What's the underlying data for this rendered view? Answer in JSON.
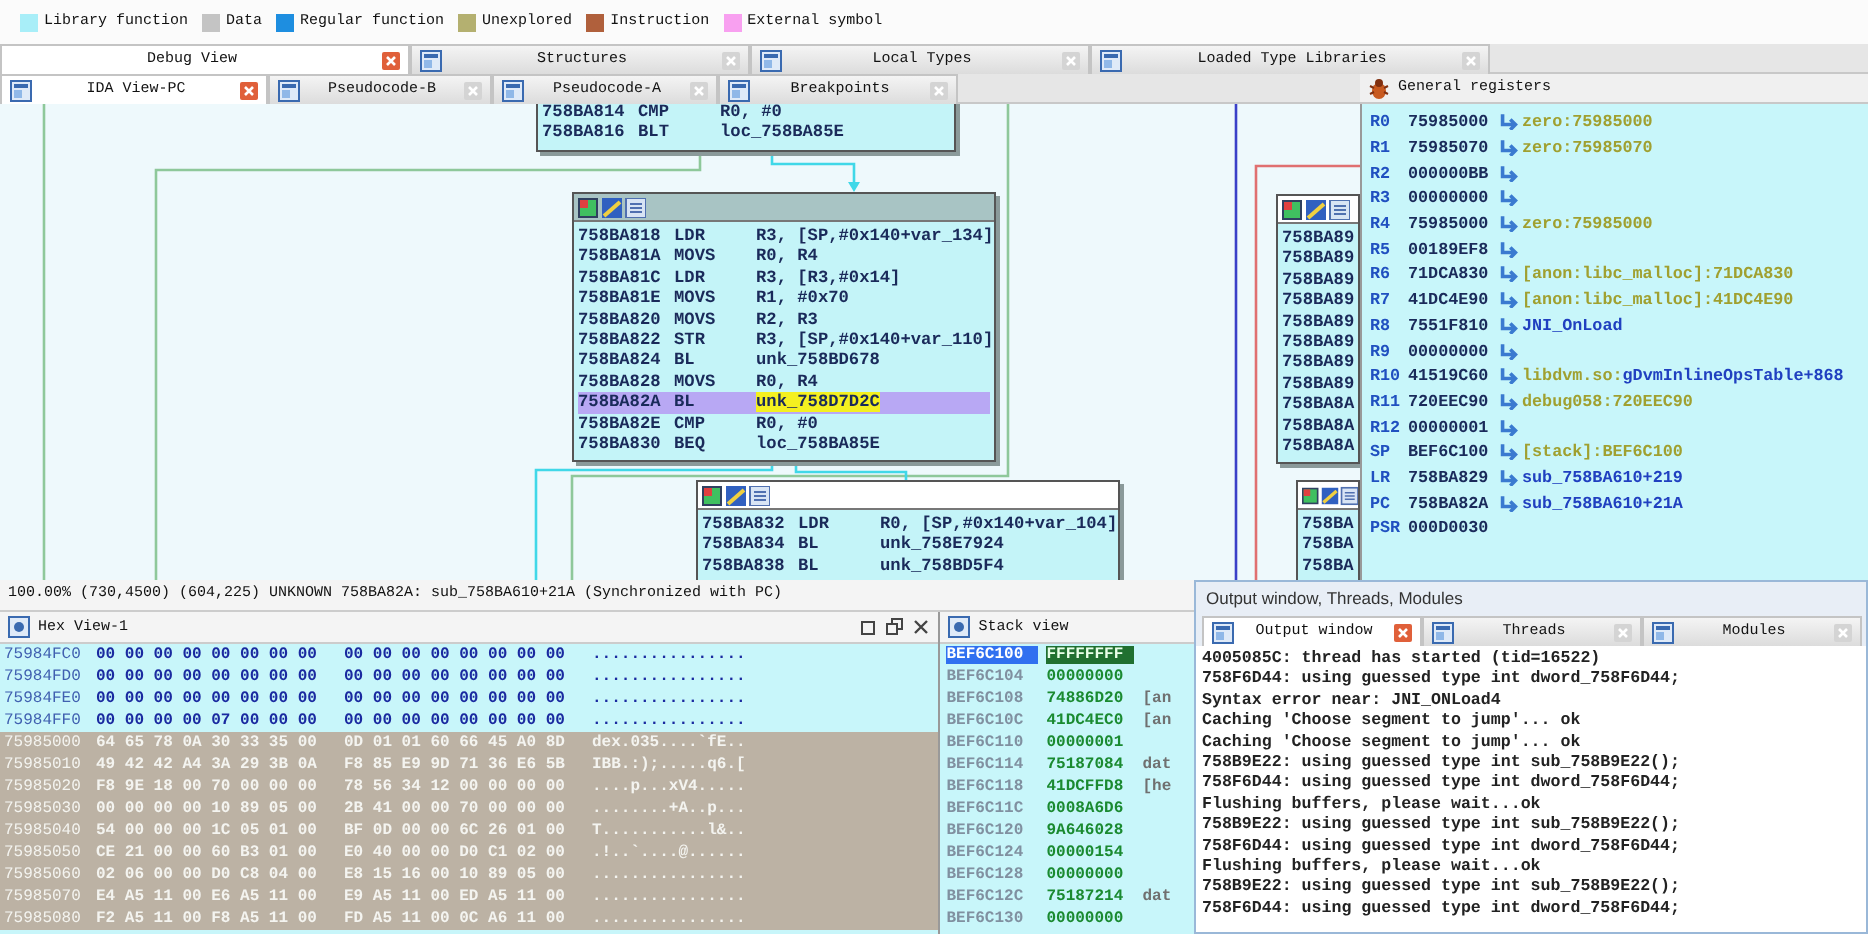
{
  "legend": [
    {
      "label": "Library function",
      "color": "#a8eef8"
    },
    {
      "label": "Data",
      "color": "#c4c4c4"
    },
    {
      "label": "Regular function",
      "color": "#1e8ee0"
    },
    {
      "label": "Unexplored",
      "color": "#b4b070"
    },
    {
      "label": "Instruction",
      "color": "#b0603c"
    },
    {
      "label": "External symbol",
      "color": "#f8a0f0"
    }
  ],
  "top_tabs": [
    {
      "label": "Debug View",
      "selected": true,
      "icon": false
    },
    {
      "label": "Structures",
      "selected": false,
      "icon": true
    },
    {
      "label": "Local Types",
      "selected": false,
      "icon": true
    },
    {
      "label": "Loaded Type Libraries",
      "selected": false,
      "icon": true
    }
  ],
  "view_tabs": [
    {
      "label": "IDA View-PC",
      "selected": true
    },
    {
      "label": "Pseudocode-B",
      "selected": false
    },
    {
      "label": "Pseudocode-A",
      "selected": false
    },
    {
      "label": "Breakpoints",
      "selected": false
    }
  ],
  "graph": {
    "nodes": [
      {
        "header": false,
        "lines": [
          {
            "addr": "758BA814",
            "op": "CMP",
            "args": "R0, #0",
            "current": false
          },
          {
            "addr": "758BA816",
            "op": "BLT",
            "args": "loc_758BA85E",
            "current": false
          }
        ]
      },
      {
        "header": true,
        "selected": true,
        "lines": [
          {
            "addr": "758BA818",
            "op": "LDR",
            "args": "R3, [SP,#0x140+var_134]",
            "current": false
          },
          {
            "addr": "758BA81A",
            "op": "MOVS",
            "args": "R0, R4",
            "current": false
          },
          {
            "addr": "758BA81C",
            "op": "LDR",
            "args": "R3, [R3,#0x14]",
            "current": false
          },
          {
            "addr": "758BA81E",
            "op": "MOVS",
            "args": "R1, #0x70",
            "current": false
          },
          {
            "addr": "758BA820",
            "op": "MOVS",
            "args": "R2, R3",
            "current": false
          },
          {
            "addr": "758BA822",
            "op": "STR",
            "args": "R3, [SP,#0x140+var_110]",
            "current": false
          },
          {
            "addr": "758BA824",
            "op": "BL",
            "args": "unk_758BD678",
            "current": false
          },
          {
            "addr": "758BA828",
            "op": "MOVS",
            "args": "R0, R4",
            "current": false
          },
          {
            "addr": "758BA82A",
            "op": "BL",
            "args": "unk_758D7D2C",
            "current": true
          },
          {
            "addr": "758BA82E",
            "op": "CMP",
            "args": "R0, #0",
            "current": false
          },
          {
            "addr": "758BA830",
            "op": "BEQ",
            "args": "loc_758BA85E",
            "current": false
          }
        ]
      },
      {
        "header": true,
        "selected": false,
        "lines": [
          {
            "addr": "758BA832",
            "op": "LDR",
            "args": "R0, [SP,#0x140+var_104]",
            "current": false
          },
          {
            "addr": "758BA834",
            "op": "BL",
            "args": "unk_758E7924",
            "current": false
          },
          {
            "addr": "758BA838",
            "op": "BL",
            "args": "unk_758BD5F4",
            "current": false
          }
        ]
      },
      {
        "header": true,
        "selected": false,
        "lines": [
          {
            "addr": "758BA89",
            "current": false
          },
          {
            "addr": "758BA89",
            "current": false
          },
          {
            "addr": "758BA89",
            "current": false
          },
          {
            "addr": "758BA89",
            "current": false
          },
          {
            "addr": "758BA89",
            "current": false
          },
          {
            "addr": "758BA89",
            "current": false
          },
          {
            "addr": "758BA89",
            "current": false
          },
          {
            "addr": "758BA89",
            "current": false
          },
          {
            "addr": "758BA8A",
            "current": false
          },
          {
            "addr": "758BA8A",
            "current": false
          },
          {
            "addr": "758BA8A",
            "current": false
          }
        ]
      },
      {
        "header": true,
        "selected": false,
        "lines": [
          {
            "addr": "758BA",
            "current": false
          },
          {
            "addr": "758BA",
            "current": false
          },
          {
            "addr": "758BA",
            "current": false
          }
        ]
      }
    ]
  },
  "registers": {
    "title": "General registers",
    "rows": [
      {
        "name": "R0",
        "value": "75985000",
        "pointer": true,
        "ref": "zero:75985000"
      },
      {
        "name": "R1",
        "value": "75985070",
        "pointer": true,
        "ref": "zero:75985070"
      },
      {
        "name": "R2",
        "value": "000000BB",
        "pointer": true
      },
      {
        "name": "R3",
        "value": "00000000",
        "pointer": true
      },
      {
        "name": "R4",
        "value": "75985000",
        "pointer": true,
        "ref": "zero:75985000"
      },
      {
        "name": "R5",
        "value": "00189EF8",
        "pointer": true
      },
      {
        "name": "R6",
        "value": "71DCA830",
        "pointer": true,
        "ref": "[anon:libc_malloc]:71DCA830"
      },
      {
        "name": "R7",
        "value": "41DC4E90",
        "pointer": true,
        "ref": "[anon:libc_malloc]:41DC4E90"
      },
      {
        "name": "R8",
        "value": "7551F810",
        "pointer": true,
        "sym": "JNI_OnLoad"
      },
      {
        "name": "R9",
        "value": "00000000",
        "pointer": true
      },
      {
        "name": "R10",
        "value": "41519C60",
        "pointer": true,
        "ref": "libdvm.so:",
        "sym": "gDvmInlineOpsTable+868"
      },
      {
        "name": "R11",
        "value": "720EEC90",
        "pointer": true,
        "ref": "debug058:720EEC90"
      },
      {
        "name": "R12",
        "value": "00000001",
        "pointer": true
      },
      {
        "name": "SP",
        "value": "BEF6C100",
        "pointer": true,
        "ref": "[stack]:BEF6C100"
      },
      {
        "name": "LR",
        "value": "758BA829",
        "pointer": true,
        "sym": "sub_758BA610+219"
      },
      {
        "name": "PC",
        "value": "758BA82A",
        "pointer": true,
        "sym": "sub_758BA610+21A"
      },
      {
        "name": "PSR",
        "value": "000D0030",
        "pointer": false
      }
    ]
  },
  "status_bar": "100.00% (730,4500) (604,225) UNKNOWN 758BA82A: sub_758BA610+21A (Synchronized with PC)",
  "hex_view": {
    "title": "Hex View-1",
    "rows": [
      {
        "addr": "75984FC0",
        "bytes_1": "00 00 00 00 00 00 00 00",
        "bytes_2": "00 00 00 00 00 00 00 00",
        "ascii": "................",
        "selected": false
      },
      {
        "addr": "75984FD0",
        "bytes_1": "00 00 00 00 00 00 00 00",
        "bytes_2": "00 00 00 00 00 00 00 00",
        "ascii": "................",
        "selected": false
      },
      {
        "addr": "75984FE0",
        "bytes_1": "00 00 00 00 00 00 00 00",
        "bytes_2": "00 00 00 00 00 00 00 00",
        "ascii": "................",
        "selected": false
      },
      {
        "addr": "75984FF0",
        "bytes_1": "00 00 00 00 07 00 00 00",
        "bytes_2": "00 00 00 00 00 00 00 00",
        "ascii": "................",
        "selected": false
      },
      {
        "addr": "75985000",
        "bytes_1": "64 65 78 0A 30 33 35 00",
        "bytes_2": "0D 01 01 60 66 45 A0 8D",
        "ascii": "dex.035....`fE..",
        "selected": true
      },
      {
        "addr": "75985010",
        "bytes_1": "49 42 42 A4 3A 29 3B 0A",
        "bytes_2": "F8 85 E9 9D 71 36 E6 5B",
        "ascii": "IBB.:);.....q6.[",
        "selected": true
      },
      {
        "addr": "75985020",
        "bytes_1": "F8 9E 18 00 70 00 00 00",
        "bytes_2": "78 56 34 12 00 00 00 00",
        "ascii": "....p...xV4.....",
        "selected": true
      },
      {
        "addr": "75985030",
        "bytes_1": "00 00 00 00 10 89 05 00",
        "bytes_2": "2B 41 00 00 70 00 00 00",
        "ascii": "........+A..p...",
        "selected": true
      },
      {
        "addr": "75985040",
        "bytes_1": "54 00 00 00 1C 05 01 00",
        "bytes_2": "BF 0D 00 00 6C 26 01 00",
        "ascii": "T...........l&..",
        "selected": true
      },
      {
        "addr": "75985050",
        "bytes_1": "CE 21 00 00 60 B3 01 00",
        "bytes_2": "E0 40 00 00 D0 C1 02 00",
        "ascii": ".!..`....@......",
        "selected": true
      },
      {
        "addr": "75985060",
        "bytes_1": "02 06 00 00 D0 C8 04 00",
        "bytes_2": "E8 15 16 00 10 89 05 00",
        "ascii": "................",
        "selected": true
      },
      {
        "addr": "75985070",
        "bytes_1": "E4 A5 11 00 E6 A5 11 00",
        "bytes_2": "E9 A5 11 00 ED A5 11 00",
        "ascii": "................",
        "selected": true
      },
      {
        "addr": "75985080",
        "bytes_1": "F2 A5 11 00 F8 A5 11 00",
        "bytes_2": "FD A5 11 00 0C A6 11 00",
        "ascii": "................",
        "selected": true
      }
    ]
  },
  "stack_view": {
    "title": "Stack view",
    "rows": [
      {
        "addr": "BEF6C100",
        "value": "FFFFFFFF",
        "selected": true
      },
      {
        "addr": "BEF6C104",
        "value": "00000000",
        "selected": false
      },
      {
        "addr": "BEF6C108",
        "value": "74886D20",
        "note": "[an",
        "selected": false
      },
      {
        "addr": "BEF6C10C",
        "value": "41DC4EC0",
        "note": "[an",
        "selected": false
      },
      {
        "addr": "BEF6C110",
        "value": "00000001",
        "selected": false
      },
      {
        "addr": "BEF6C114",
        "value": "75187084",
        "note": "dat",
        "selected": false
      },
      {
        "addr": "BEF6C118",
        "value": "41DCFFD8",
        "note": "[he",
        "selected": false
      },
      {
        "addr": "BEF6C11C",
        "value": "0008A6D6",
        "selected": false
      },
      {
        "addr": "BEF6C120",
        "value": "9A646028",
        "selected": false
      },
      {
        "addr": "BEF6C124",
        "value": "00000154",
        "selected": false
      },
      {
        "addr": "BEF6C128",
        "value": "00000000",
        "selected": false
      },
      {
        "addr": "BEF6C12C",
        "value": "75187214",
        "note": "dat",
        "selected": false
      },
      {
        "addr": "BEF6C130",
        "value": "00000000",
        "selected": false
      }
    ]
  },
  "output_window": {
    "title": "Output window, Threads, Modules",
    "tabs": [
      {
        "label": "Output window",
        "selected": true
      },
      {
        "label": "Threads",
        "selected": false
      },
      {
        "label": "Modules",
        "selected": false
      }
    ],
    "lines": [
      "4005085C: thread has started (tid=16522)",
      "758F6D44: using guessed type int dword_758F6D44;",
      "Syntax error near: JNI_ONLoad4",
      "Caching 'Choose segment to jump'... ok",
      "Caching 'Choose segment to jump'... ok",
      "758B9E22: using guessed type int sub_758B9E22();",
      "758F6D44: using guessed type int dword_758F6D44;",
      "Flushing buffers, please wait...ok",
      "758B9E22: using guessed type int sub_758B9E22();",
      "758F6D44: using guessed type int dword_758F6D44;",
      "Flushing buffers, please wait...ok",
      "758B9E22: using guessed type int sub_758B9E22();",
      "758F6D44: using guessed type int dword_758F6D44;"
    ]
  }
}
